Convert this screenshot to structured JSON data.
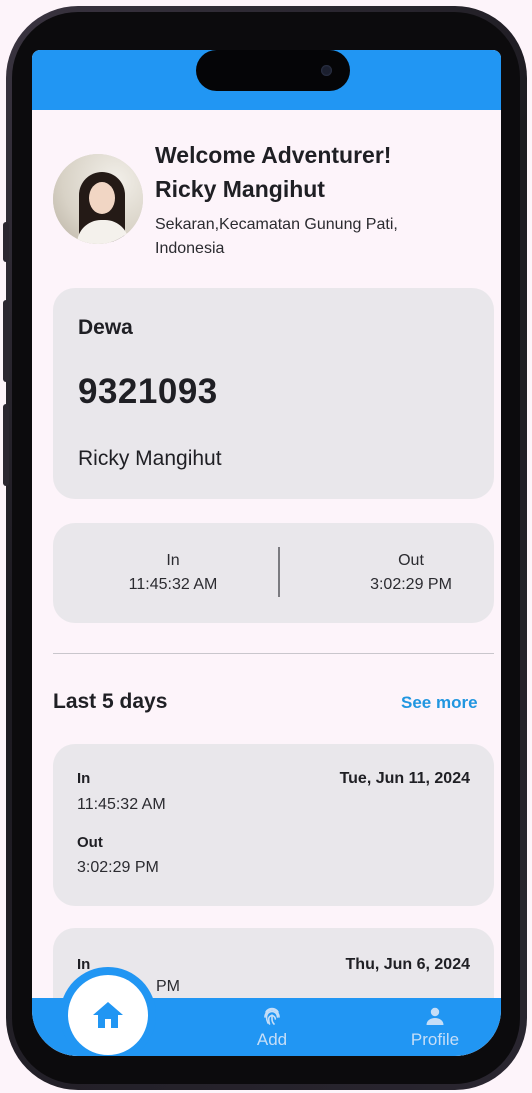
{
  "header": {
    "welcome": "Welcome Adventurer!",
    "user_name": "Ricky Mangihut",
    "location": "Sekaran,Kecamatan Gunung Pati, Indonesia"
  },
  "id_card": {
    "group": "Dewa",
    "number": "9321093",
    "owner": "Ricky Mangihut"
  },
  "today": {
    "in_label": "In",
    "in_time": "11:45:32 AM",
    "out_label": "Out",
    "out_time": "3:02:29 PM"
  },
  "history": {
    "title": "Last 5 days",
    "see_more": "See more",
    "records": [
      {
        "in_label": "In",
        "in_time": "11:45:32 AM",
        "out_label": "Out",
        "out_time": "3:02:29 PM",
        "date": "Tue, Jun 11, 2024"
      },
      {
        "in_label": "In",
        "in_time": "PM",
        "date": "Thu, Jun 6, 2024"
      }
    ]
  },
  "bottom_nav": {
    "items": [
      {
        "label": "",
        "icon": "home-icon"
      },
      {
        "label": "Add",
        "icon": "fingerprint-icon"
      },
      {
        "label": "Profile",
        "icon": "person-icon"
      }
    ]
  },
  "colors": {
    "primary": "#2196f3",
    "link": "#2196e0",
    "background": "#fdf4fa",
    "card": "#e9e7eb"
  }
}
